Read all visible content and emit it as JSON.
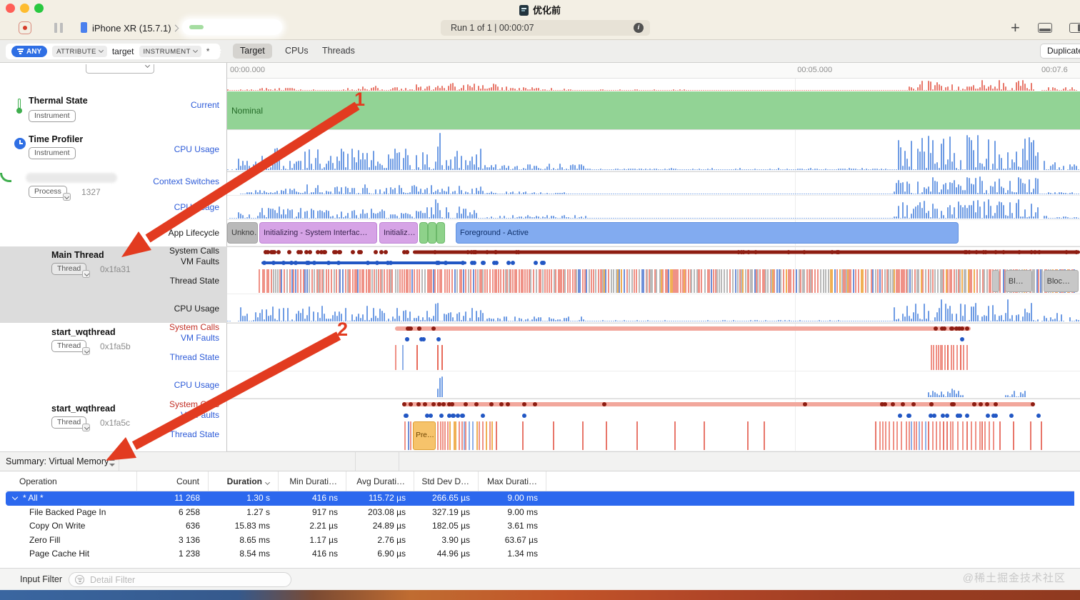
{
  "titlebar": {
    "title": "优化前",
    "device": "iPhone XR (15.7.1)",
    "run_text": "Run 1 of 1  |  00:00:07"
  },
  "filterbar": {
    "scope": "ANY",
    "attribute": "ATTRIBUTE",
    "target_token": "target",
    "instrument": "INSTRUMENT",
    "wildcard": "*",
    "tabs": [
      "Target",
      "CPUs",
      "Threads"
    ],
    "duplicate": "Duplicate"
  },
  "ruler": {
    "t0": "00:00.000",
    "t1": "00:05.000",
    "t2": "00:07.6"
  },
  "tracks": {
    "thermal": {
      "name": "Thermal State",
      "badge": "Instrument",
      "lane_current": "Current"
    },
    "profiler": {
      "name": "Time Profiler",
      "badge": "Instrument",
      "lane_cpu": "CPU Usage"
    },
    "process": {
      "badge": "Process",
      "pid": "1327",
      "lane_ctx": "Context Switches",
      "lane_cpu": "CPU Usage",
      "lane_lifecycle": "App Lifecycle"
    },
    "main": {
      "name": "Main Thread",
      "badge": "Thread",
      "tid": "0x1fa31",
      "lane_sys": "System Calls",
      "lane_vm": "VM Faults",
      "lane_state": "Thread State",
      "lane_cpu": "CPU Usage"
    },
    "wq1": {
      "name": "start_wqthread",
      "badge": "Thread",
      "tid": "0x1fa5b",
      "lane_sys": "System Calls",
      "lane_vm": "VM Faults",
      "lane_state": "Thread State",
      "lane_cpu": "CPU Usage"
    },
    "wq2": {
      "name": "start_wqthread",
      "badge": "Thread",
      "tid": "0x1fa5c",
      "lane_sys": "System Calls",
      "lane_vm": "VM Faults",
      "lane_state": "Thread State"
    }
  },
  "timeline": {
    "nominal": "Nominal",
    "lifecycle_labels": [
      "Unkno…",
      "Initializing - System Interfac…",
      "Initializ…",
      "Foreground - Active"
    ],
    "blocked_labels": [
      "Bl…",
      "Bloc…"
    ],
    "preempted_label": "Pre…"
  },
  "summary": {
    "title": "Summary: Virtual Memory",
    "columns": [
      "Operation",
      "Count",
      "Duration",
      "Min Durati…",
      "Avg Durati…",
      "Std Dev D…",
      "Max Durati…"
    ],
    "rows": [
      {
        "operation": "* All *",
        "count": "11 268",
        "duration": "1.30 s",
        "min": "416 ns",
        "avg": "115.72 µs",
        "std": "266.65 µs",
        "max": "9.00 ms",
        "selected": true
      },
      {
        "operation": "File Backed Page In",
        "count": "6 258",
        "duration": "1.27 s",
        "min": "917 ns",
        "avg": "203.08 µs",
        "std": "327.19 µs",
        "max": "9.00 ms"
      },
      {
        "operation": "Copy On Write",
        "count": "636",
        "duration": "15.83 ms",
        "min": "2.21 µs",
        "avg": "24.89 µs",
        "std": "182.05 µs",
        "max": "3.61 ms"
      },
      {
        "operation": "Zero Fill",
        "count": "3 136",
        "duration": "8.65 ms",
        "min": "1.17 µs",
        "avg": "2.76 µs",
        "std": "3.90 µs",
        "max": "63.67 µs"
      },
      {
        "operation": "Page Cache Hit",
        "count": "1 238",
        "duration": "8.54 ms",
        "min": "416 ns",
        "avg": "6.90 µs",
        "std": "44.96 µs",
        "max": "1.34 ms"
      }
    ]
  },
  "bottombar": {
    "label": "Input Filter",
    "placeholder": "Detail Filter"
  },
  "annotations": {
    "n1": "1",
    "n2": "2"
  },
  "watermark": "@稀土掘金技术社区",
  "colors": {
    "accent_blue": "#2d5bd8",
    "link_red": "#c22f25",
    "selection_blue": "#2c68ee",
    "nominal_green": "#92d395",
    "hist_blue": "#6f9ce4",
    "syscall_red": "#8e1d12",
    "salmon": "#f2a79c",
    "arrow_red": "#e23b20"
  },
  "viz": {
    "hist": {
      "red_top": {
        "color": "#e8796c",
        "seed": 11,
        "dotted": true,
        "pow": 1.6,
        "regions": [
          [
            0.0,
            0.035,
            0.15
          ],
          [
            0.035,
            0.09,
            0.3
          ],
          [
            0.09,
            0.14,
            0.12
          ],
          [
            0.14,
            0.22,
            0.45
          ],
          [
            0.22,
            0.33,
            0.7
          ],
          [
            0.33,
            0.4,
            0.3
          ],
          [
            0.4,
            0.56,
            0.15
          ],
          [
            0.56,
            0.79,
            0.05
          ],
          [
            0.79,
            0.945,
            0.95
          ],
          [
            0.955,
            0.995,
            0.35
          ]
        ]
      },
      "tp_cpu": {
        "color": "#6f9ce4",
        "seed": 21,
        "dotted": true,
        "pow": 1.5,
        "regions": [
          [
            0.01,
            0.04,
            0.3
          ],
          [
            0.04,
            0.3,
            0.55
          ],
          [
            0.243,
            0.252,
            1.0
          ],
          [
            0.3,
            0.42,
            0.18
          ],
          [
            0.42,
            0.78,
            0.05
          ],
          [
            0.78,
            0.95,
            0.9
          ],
          [
            0.955,
            0.98,
            0.3
          ],
          [
            0.985,
            1.0,
            0.2
          ]
        ]
      },
      "ctx": {
        "color": "#6f9ce4",
        "seed": 22,
        "dotted": true,
        "pow": 1.5,
        "regions": [
          [
            0.02,
            0.065,
            0.2
          ],
          [
            0.065,
            0.3,
            0.45
          ],
          [
            0.247,
            0.256,
            0.95
          ],
          [
            0.3,
            0.4,
            0.15
          ],
          [
            0.4,
            0.78,
            0.05
          ],
          [
            0.78,
            0.95,
            0.8
          ],
          [
            0.955,
            1.0,
            0.12
          ]
        ]
      },
      "proc_cpu": {
        "color": "#6f9ce4",
        "seed": 23,
        "dotted": true,
        "pow": 1.5,
        "regions": [
          [
            0.01,
            0.04,
            0.3
          ],
          [
            0.04,
            0.3,
            0.55
          ],
          [
            0.243,
            0.252,
            1.0
          ],
          [
            0.3,
            0.42,
            0.18
          ],
          [
            0.42,
            0.78,
            0.05
          ],
          [
            0.78,
            0.95,
            0.9
          ],
          [
            0.955,
            1.0,
            0.2
          ]
        ]
      },
      "main_cpu": {
        "color": "#6f9ce4",
        "seed": 24,
        "dotted": true,
        "pow": 1.5,
        "regions": [
          [
            0.012,
            0.3,
            0.6
          ],
          [
            0.243,
            0.252,
            1.0
          ],
          [
            0.3,
            0.42,
            0.2
          ],
          [
            0.42,
            0.78,
            0.06
          ],
          [
            0.78,
            0.95,
            0.85
          ],
          [
            0.955,
            0.98,
            0.35
          ],
          [
            0.985,
            1.0,
            0.2
          ]
        ]
      },
      "wq1_cpu": {
        "color": "#6f9ce4",
        "seed": 25,
        "dotted": false,
        "pow": 1.2,
        "regions": [
          [
            0.244,
            0.252,
            0.95
          ],
          [
            0.82,
            0.864,
            0.35
          ],
          [
            0.91,
            0.935,
            0.28
          ]
        ]
      }
    },
    "dotlanes": {
      "m_sys": {
        "seed": 31,
        "color": "#8e1d12",
        "bar": [
          0.218,
          1.0,
          5
        ],
        "dot_r": 3,
        "dots": [
          [
            0.038,
            0.215,
            30
          ],
          [
            0.24,
            0.36,
            12
          ],
          [
            0.55,
            0.72,
            10
          ],
          [
            0.85,
            0.995,
            14
          ]
        ]
      },
      "m_vm": {
        "seed": 32,
        "color": "#2257c4",
        "bar": [
          0.04,
          0.28,
          4
        ],
        "dot_r": 3,
        "dots": [
          [
            0.04,
            0.28,
            18
          ],
          [
            0.282,
            0.3,
            4
          ],
          [
            0.305,
            0.315,
            2
          ],
          [
            0.325,
            0.335,
            2
          ],
          [
            0.358,
            0.375,
            3
          ]
        ]
      },
      "w1_sys": {
        "seed": 33,
        "color": "#8e1d12",
        "barcolor": "#f2a79c",
        "bar": [
          0.197,
          0.872,
          6
        ],
        "dot_r": 3,
        "dots": [
          [
            0.198,
            0.225,
            5
          ],
          [
            0.232,
            0.24,
            1
          ],
          [
            0.826,
            0.87,
            9
          ]
        ]
      },
      "w1_vm": {
        "seed": 34,
        "color": "#2257c4",
        "bar": null,
        "dot_r": 3,
        "dots": [
          [
            0.2,
            0.212,
            2
          ],
          [
            0.22,
            0.228,
            2
          ],
          [
            0.245,
            0.25,
            1
          ],
          [
            0.858,
            0.864,
            1
          ]
        ]
      },
      "w2_sys": {
        "seed": 35,
        "color": "#8e1d12",
        "barcolor": "#f2a79c",
        "bar": [
          0.205,
          0.945,
          6
        ],
        "dot_r": 3,
        "dots": [
          [
            0.205,
            0.222,
            3
          ],
          [
            0.228,
            0.295,
            9
          ],
          [
            0.3,
            0.33,
            3
          ],
          [
            0.343,
            0.36,
            2
          ],
          [
            0.435,
            0.442,
            1
          ],
          [
            0.673,
            0.68,
            1
          ],
          [
            0.76,
            0.882,
            13
          ],
          [
            0.888,
            0.9,
            2
          ],
          [
            0.942,
            0.95,
            1
          ]
        ]
      },
      "w2_vm": {
        "seed": 36,
        "color": "#2257c4",
        "bar": null,
        "dot_r": 3,
        "dots": [
          [
            0.205,
            0.215,
            2
          ],
          [
            0.225,
            0.24,
            2
          ],
          [
            0.245,
            0.3,
            8
          ],
          [
            0.343,
            0.352,
            1
          ],
          [
            0.775,
            0.8,
            3
          ],
          [
            0.808,
            0.868,
            8
          ],
          [
            0.875,
            0.9,
            3
          ],
          [
            0.913,
            0.92,
            1
          ],
          [
            0.944,
            0.952,
            1
          ]
        ]
      }
    },
    "stripes": {
      "m_state": {
        "seed": 41,
        "regions": [
          {
            "from": 0.037,
            "to": 0.44,
            "step": 3,
            "colors": [
              [
                "#ef9186",
                0.72
              ],
              [
                "#6e8fd8",
                0.1
              ],
              [
                "#b9b9b9",
                0.18
              ]
            ]
          },
          {
            "from": 0.44,
            "to": 0.995,
            "step": 3,
            "colors": [
              [
                "#ef9186",
                0.5
              ],
              [
                "#6e8fd8",
                0.12
              ],
              [
                "#b9b9b9",
                0.3
              ],
              [
                "#f0b054",
                0.08
              ]
            ]
          }
        ]
      },
      "w1_state": {
        "seed": 42,
        "regions": [
          {
            "from": 0.197,
            "to": 0.212,
            "step": 8,
            "colors": [
              [
                "#8fb0e8",
                0.5
              ],
              [
                "#ef9186",
                0.5
              ]
            ]
          },
          {
            "from": 0.222,
            "to": 0.228,
            "step": 7,
            "colors": [
              [
                "#e86a5a",
                1
              ]
            ]
          },
          {
            "from": 0.246,
            "to": 0.252,
            "step": 7,
            "colors": [
              [
                "#e86a5a",
                1
              ]
            ]
          },
          {
            "from": 0.825,
            "to": 0.868,
            "step": 4,
            "colors": [
              [
                "#ef9186",
                0.75
              ],
              [
                "#e86a5a",
                0.25
              ]
            ]
          }
        ]
      },
      "w2_state": {
        "seed": 43,
        "regions": [
          {
            "from": 0.208,
            "to": 0.218,
            "step": 5,
            "colors": [
              [
                "#ef9186",
                0.7
              ],
              [
                "#6e8fd8",
                0.3
              ]
            ]
          },
          {
            "from": 0.246,
            "to": 0.31,
            "step": 4,
            "colors": [
              [
                "#ef9186",
                0.55
              ],
              [
                "#f0b054",
                0.3
              ],
              [
                "#8fb0e8",
                0.15
              ]
            ]
          },
          {
            "from": 0.315,
            "to": 0.46,
            "step": 30,
            "colors": [
              [
                "#e8766a",
                1
              ]
            ]
          },
          {
            "from": 0.48,
            "to": 0.64,
            "step": 45,
            "colors": [
              [
                "#e8766a",
                1
              ]
            ]
          },
          {
            "from": 0.76,
            "to": 0.9,
            "step": 5,
            "colors": [
              [
                "#ef9186",
                0.7
              ],
              [
                "#e8766a",
                0.2
              ],
              [
                "#8fb0e8",
                0.1
              ]
            ]
          },
          {
            "from": 0.905,
            "to": 0.955,
            "step": 18,
            "colors": [
              [
                "#e8766a",
                1
              ]
            ]
          }
        ]
      }
    },
    "lifecycle_segs": [
      {
        "li": 0,
        "from": 0.0,
        "to": 0.036,
        "type": "gray"
      },
      {
        "li": 1,
        "from": 0.038,
        "to": 0.176,
        "type": "purple"
      },
      {
        "li": 2,
        "from": 0.178,
        "to": 0.223,
        "type": "purple"
      },
      {
        "from": 0.2255,
        "to": 0.2335,
        "type": "green"
      },
      {
        "from": 0.2355,
        "to": 0.2435,
        "type": "green"
      },
      {
        "from": 0.2455,
        "to": 0.2525,
        "type": "green"
      },
      {
        "li": 3,
        "from": 0.268,
        "to": 0.858,
        "type": "blue"
      }
    ],
    "blocked_segs": [
      {
        "from": 0.897,
        "to": 0.905
      },
      {
        "bi": 0,
        "from": 0.912,
        "to": 0.944
      },
      {
        "bi": 1,
        "from": 0.957,
        "to": 0.998
      }
    ],
    "pre_seg": {
      "from": 0.218,
      "to": 0.2445
    }
  }
}
